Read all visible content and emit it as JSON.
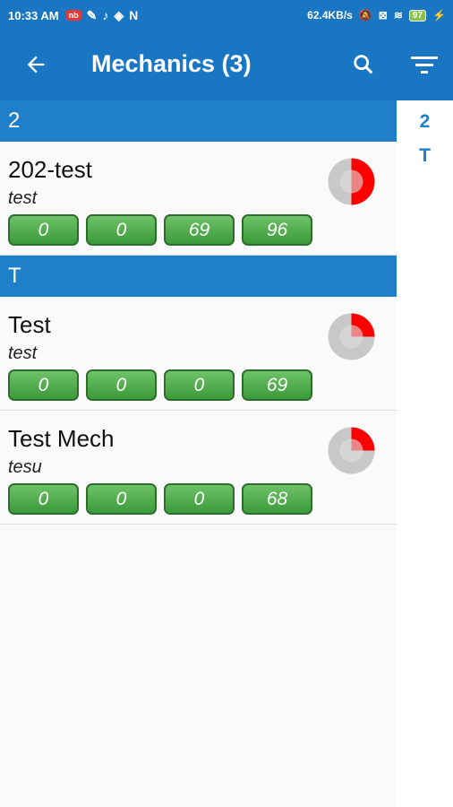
{
  "status_bar": {
    "time": "10:33 AM",
    "notif_badge": "nb",
    "speed": "62.4KB/s",
    "battery": "97"
  },
  "app_bar": {
    "title": "Mechanics (3)",
    "back_icon": "arrow-back-icon",
    "search_icon": "search-icon",
    "filter_icon": "filter-list-icon"
  },
  "sections": [
    {
      "header": "2",
      "items": [
        {
          "name": "202-test",
          "subtitle": "test",
          "counts": [
            "0",
            "0",
            "69",
            "96"
          ],
          "progress": 0.5
        }
      ]
    },
    {
      "header": "T",
      "items": [
        {
          "name": "Test",
          "subtitle": "test",
          "counts": [
            "0",
            "0",
            "0",
            "69"
          ],
          "progress": 0.25
        },
        {
          "name": "Test Mech",
          "subtitle": "tesu",
          "counts": [
            "0",
            "0",
            "0",
            "68"
          ],
          "progress": 0.25
        }
      ]
    }
  ],
  "index": [
    "2",
    "T"
  ],
  "colors": {
    "primary": "#1976c2",
    "section_header": "#1f7fc8",
    "badge_green": "#4caf50",
    "progress_red": "#ff0000",
    "progress_gray": "#c8c8c8"
  }
}
